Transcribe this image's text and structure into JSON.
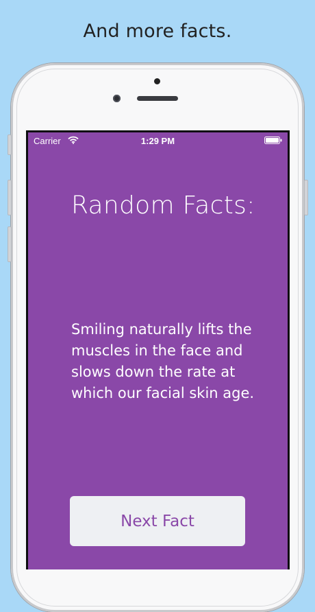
{
  "caption": "And more facts.",
  "status_bar": {
    "carrier": "Carrier",
    "time": "1:29 PM"
  },
  "app": {
    "title": "Random Facts:",
    "fact": "Smiling naturally lifts the muscles in the face and slows down the rate at which our facial skin age.",
    "button_label": "Next Fact"
  },
  "colors": {
    "background": "#a9d8f7",
    "app_purple": "#8a48a8",
    "button_bg": "#eef0f3"
  },
  "icons": {
    "wifi": "wifi-icon",
    "battery": "battery-icon"
  }
}
